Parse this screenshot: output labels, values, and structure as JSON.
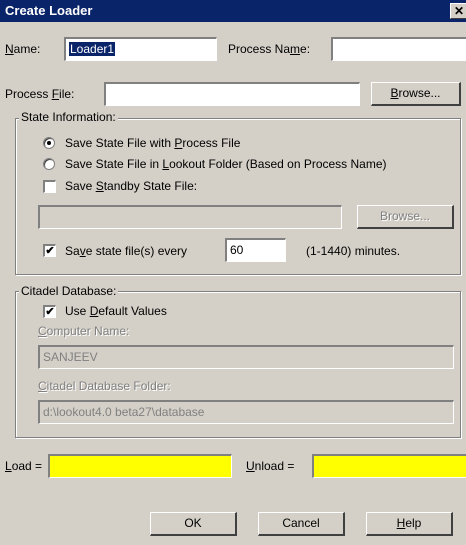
{
  "window": {
    "title": "Create Loader",
    "close_glyph": "✕"
  },
  "general": {
    "name_label_u": "N",
    "name_label_rest": "ame:",
    "name_value": "Loader1",
    "process_name_label_a": "Process Na",
    "process_name_label_u": "m",
    "process_name_label_b": "e:",
    "process_name_value": "",
    "process_file_label_a": "Process ",
    "process_file_label_u": "F",
    "process_file_label_b": "ile:",
    "process_file_value": "",
    "browse_a": "",
    "browse_u": "B",
    "browse_b": "rowse..."
  },
  "state_info": {
    "title": "State Information:",
    "radio1_a": "Save State File with ",
    "radio1_u": "P",
    "radio1_b": "rocess File",
    "radio2_a": "Save State File in ",
    "radio2_u": "L",
    "radio2_b": "ookout Folder (Based on Process Name)",
    "standby_a": "Save ",
    "standby_u": "S",
    "standby_b": "tandby State File:",
    "standby_value": "",
    "browse_label": "Browse...",
    "every_a": "Sa",
    "every_u": "v",
    "every_b": "e state file(s) every",
    "every_value": "60",
    "every_hint": "(1-1440) minutes.",
    "radio1_checked": true,
    "radio2_checked": false,
    "standby_checked": false,
    "every_checked": true
  },
  "citadel": {
    "title": "Citadel Database:",
    "use_default_a": "Use ",
    "use_default_u": "D",
    "use_default_b": "efault Values",
    "use_default_checked": true,
    "computer_name_label_u": "C",
    "computer_name_label_rest": "omputer Name:",
    "computer_name_value": "SANJEEV",
    "folder_label_u": "C",
    "folder_label_rest": "itadel Database Folder:",
    "folder_value": "d:\\lookout4.0 beta27\\database"
  },
  "bottom": {
    "load_u": "L",
    "load_rest": "oad =",
    "load_value": "",
    "unload_u": "U",
    "unload_rest": "nload =",
    "unload_value": "",
    "ok": "OK",
    "cancel": "Cancel",
    "help_u": "H",
    "help_rest": "elp",
    "field_color": "#ffff00"
  },
  "check_glyph": "✔"
}
